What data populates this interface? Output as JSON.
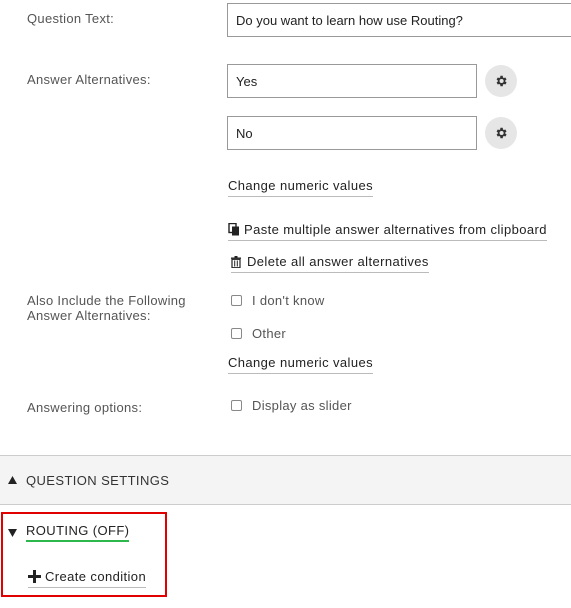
{
  "question_text": {
    "label": "Question Text:",
    "value": "Do you want to learn how use Routing?"
  },
  "answer_alternatives": {
    "label": "Answer Alternatives:",
    "items": [
      {
        "value": "Yes",
        "settings_icon": "gear-icon"
      },
      {
        "value": "No",
        "settings_icon": "gear-icon"
      }
    ],
    "change_numeric_label": "Change numeric values",
    "paste_label": "Paste multiple answer alternatives from clipboard",
    "paste_icon": "clipboard-icon",
    "delete_label": "Delete all answer alternatives",
    "delete_icon": "trash-icon"
  },
  "also_include": {
    "label": "Also Include the Following Answer Alternatives:",
    "options": [
      {
        "label": "I don't know",
        "checked": false
      },
      {
        "label": "Other",
        "checked": false
      }
    ],
    "change_numeric_label": "Change numeric values"
  },
  "answering_options": {
    "label": "Answering options:",
    "option_label": "Display as slider",
    "checked": false
  },
  "question_settings": {
    "title": "QUESTION SETTINGS",
    "icon": "triangle-up-icon"
  },
  "routing": {
    "title": "ROUTING (OFF)",
    "icon": "triangle-down-icon",
    "underline_color": "#2db84d",
    "create_condition_label": "Create condition",
    "create_icon": "plus-icon"
  },
  "colors": {
    "highlight_border": "#e00000",
    "section_bg": "#f4f4f4"
  }
}
